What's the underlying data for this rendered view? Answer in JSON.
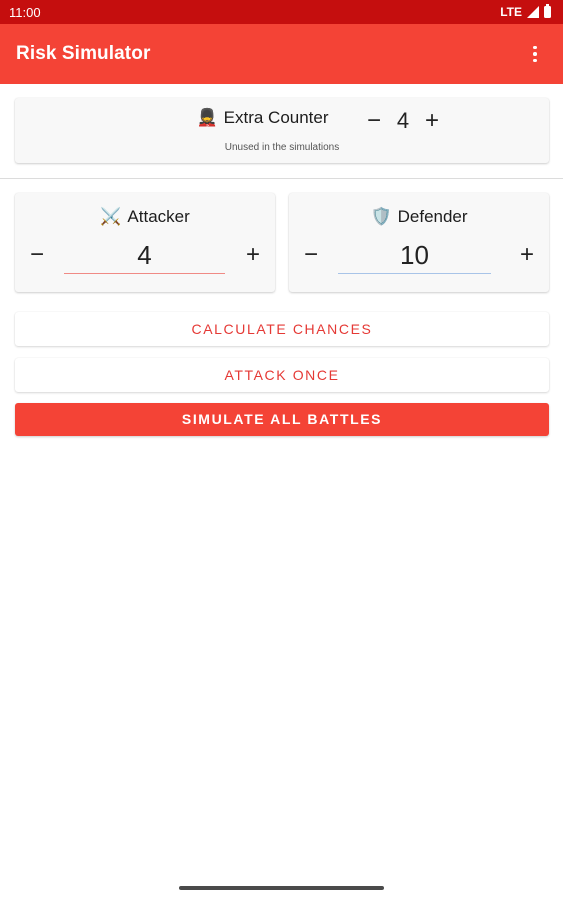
{
  "status_bar": {
    "time": "11:00",
    "network": "LTE"
  },
  "app_bar": {
    "title": "Risk Simulator",
    "menu_icon": "more-vert-icon"
  },
  "extra_counter": {
    "emoji": "💂",
    "label": "Extra Counter",
    "value": "4",
    "caption": "Unused in the simulations",
    "minus_symbol": "−",
    "plus_symbol": "+"
  },
  "attacker": {
    "emoji": "⚔️",
    "label": "Attacker",
    "value": "4",
    "minus_symbol": "−",
    "plus_symbol": "+"
  },
  "defender": {
    "emoji": "🛡️",
    "label": "Defender",
    "value": "10",
    "minus_symbol": "−",
    "plus_symbol": "+"
  },
  "buttons": {
    "calculate": "CALCULATE CHANCES",
    "attack_once": "ATTACK ONCE",
    "simulate_all": "SIMULATE ALL BATTLES"
  },
  "colors": {
    "primary": "#f44336",
    "status_bar": "#c50e0e",
    "accent_text": "#e53935"
  }
}
